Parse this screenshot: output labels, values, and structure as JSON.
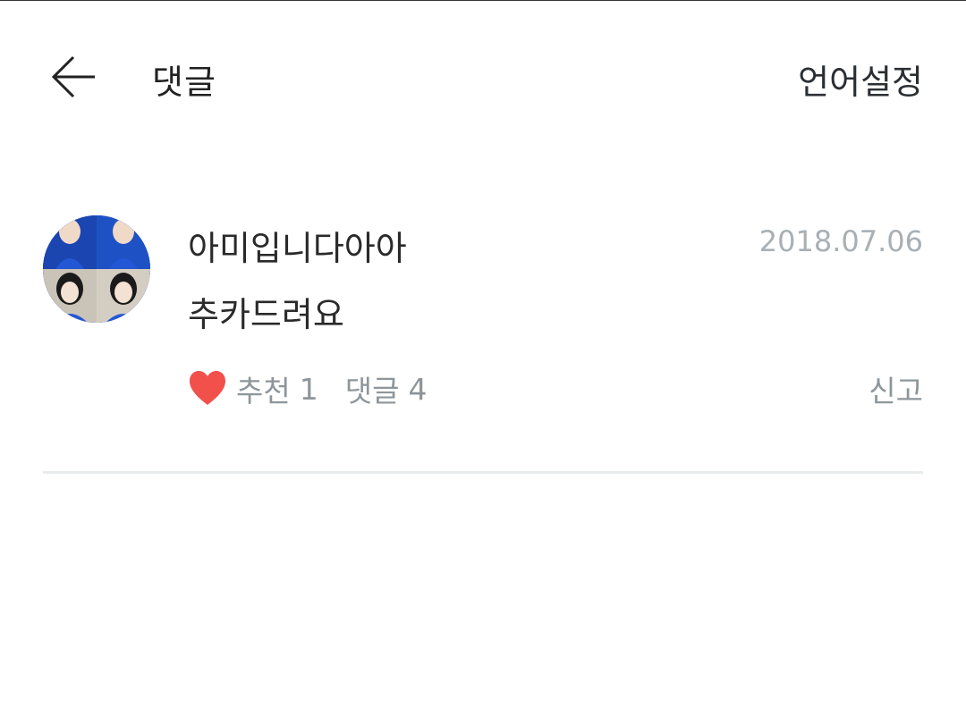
{
  "header": {
    "back_icon": "arrow-left-icon",
    "title": "댓글",
    "language_settings_label": "언어설정"
  },
  "comment": {
    "username": "아미입니다아아",
    "date": "2018.07.06",
    "text": "추카드려요",
    "like_label": "추천",
    "like_count": "1",
    "reply_label": "댓글",
    "reply_count": "4",
    "report_label": "신고",
    "heart_color": "#f2504b"
  },
  "colors": {
    "text_primary": "#2a2a2a",
    "text_secondary": "#8e969b",
    "date_color": "#a9b0b5",
    "divider": "#e8ebec",
    "avatar_blue": "#1d4fbf"
  }
}
